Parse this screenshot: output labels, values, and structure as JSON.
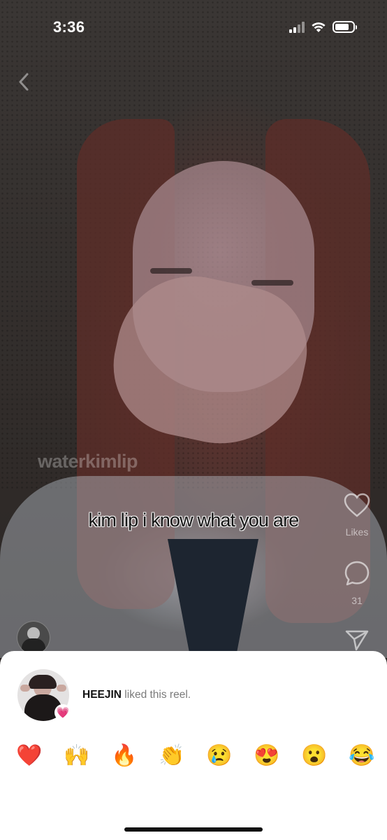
{
  "status_bar": {
    "time": "3:36",
    "battery_fraction": 0.8
  },
  "reel": {
    "watermark": "waterkimlip",
    "caption": "kim lip i know what you are"
  },
  "side_rail": {
    "likes_label": "Likes",
    "comments_count": "31"
  },
  "like_sheet": {
    "username": "HEEJIN",
    "action_text": " liked this reel.",
    "avatar_badge": "💗",
    "reactions": [
      "❤️",
      "🙌",
      "🔥",
      "👏",
      "😢",
      "😍",
      "😮",
      "😂"
    ]
  },
  "colors": {
    "sheet_bg": "#ffffff",
    "home_indicator": "#111111"
  }
}
